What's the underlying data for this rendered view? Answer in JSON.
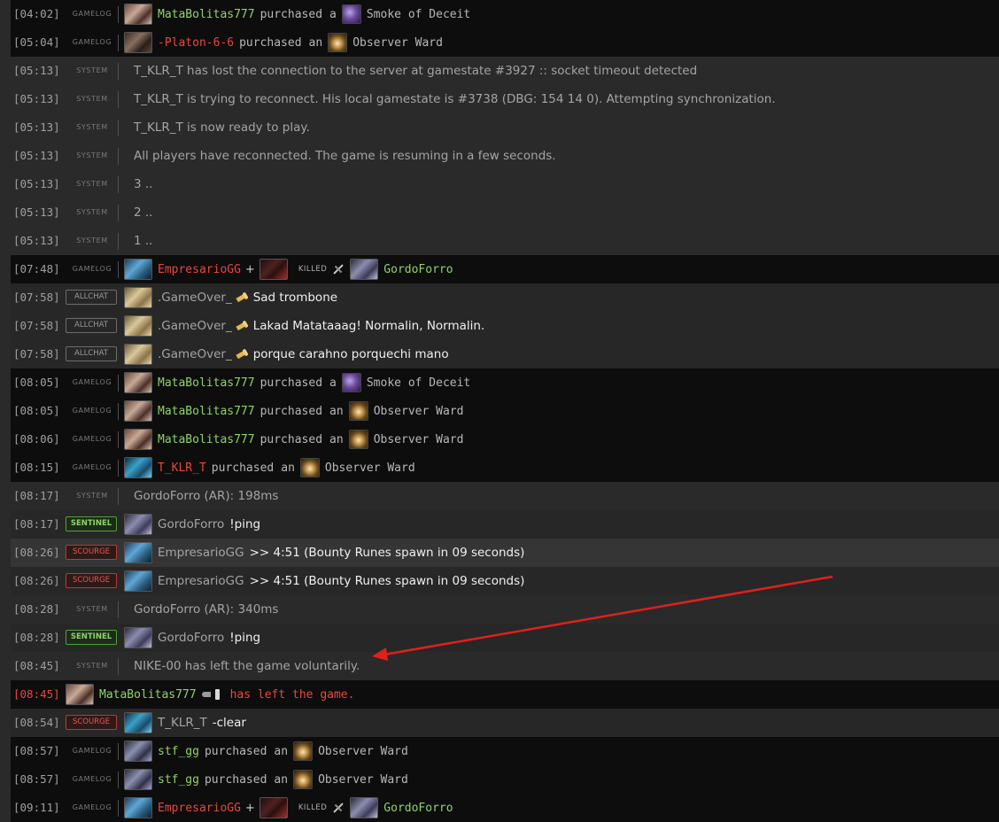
{
  "log": [
    {
      "kind": "gamelog",
      "time": "[04:02]",
      "tag": "GAMELOG",
      "avatar": "av-brown",
      "player": "MataBolitas777",
      "player_color": "green",
      "verb": "purchased",
      "article": "a",
      "item_icon": "ic-smoke",
      "item": "Smoke of Deceit"
    },
    {
      "kind": "gamelog",
      "time": "[05:04]",
      "tag": "GAMELOG",
      "avatar": "av-dark",
      "player": "-Platon-6-6",
      "player_color": "red",
      "verb": "purchased",
      "article": "an",
      "item_icon": "ic-ward",
      "item": "Observer Ward"
    },
    {
      "kind": "system",
      "time": "[05:13]",
      "tag": "SYSTEM",
      "text": "T_KLR_T has lost the connection to the server at gamestate #3927 :: socket timeout detected"
    },
    {
      "kind": "system",
      "time": "[05:13]",
      "tag": "SYSTEM",
      "text": "T_KLR_T is trying to reconnect. His local gamestate is #3738 (DBG: 154 14 0). Attempting synchronization."
    },
    {
      "kind": "system",
      "time": "[05:13]",
      "tag": "SYSTEM",
      "text": "T_KLR_T is now ready to play."
    },
    {
      "kind": "system",
      "time": "[05:13]",
      "tag": "SYSTEM",
      "text": "All players have reconnected. The game is resuming in a few seconds."
    },
    {
      "kind": "system",
      "time": "[05:13]",
      "tag": "SYSTEM",
      "text": "3 .."
    },
    {
      "kind": "system",
      "time": "[05:13]",
      "tag": "SYSTEM",
      "text": "2 .."
    },
    {
      "kind": "system",
      "time": "[05:13]",
      "tag": "SYSTEM",
      "text": "1 .."
    },
    {
      "kind": "kill",
      "time": "[07:48]",
      "tag": "GAMELOG",
      "avatar": "av-blue",
      "player": "EmpresarioGG",
      "plus": "+",
      "assist_avatar": "av-red",
      "killed": "KILLED",
      "victim_avatar": "av-purple",
      "victim": "GordoForro"
    },
    {
      "kind": "chat",
      "chan": "allchat",
      "time": "[07:58]",
      "chip": "ALLCHAT",
      "avatar": "av-tan",
      "player": ".GameOver_",
      "horn": true,
      "message": "Sad trombone"
    },
    {
      "kind": "chat",
      "chan": "allchat",
      "time": "[07:58]",
      "chip": "ALLCHAT",
      "avatar": "av-tan",
      "player": ".GameOver_",
      "horn": true,
      "message": "Lakad Matataaag! Normalin, Normalin."
    },
    {
      "kind": "chat",
      "chan": "allchat",
      "time": "[07:58]",
      "chip": "ALLCHAT",
      "avatar": "av-tan",
      "player": ".GameOver_",
      "horn": true,
      "message": "porque carahno porquechi mano"
    },
    {
      "kind": "gamelog",
      "time": "[08:05]",
      "tag": "GAMELOG",
      "avatar": "av-brown",
      "player": "MataBolitas777",
      "player_color": "green",
      "verb": "purchased",
      "article": "a",
      "item_icon": "ic-smoke",
      "item": "Smoke of Deceit"
    },
    {
      "kind": "gamelog",
      "time": "[08:05]",
      "tag": "GAMELOG",
      "avatar": "av-brown",
      "player": "MataBolitas777",
      "player_color": "green",
      "verb": "purchased",
      "article": "an",
      "item_icon": "ic-ward",
      "item": "Observer Ward"
    },
    {
      "kind": "gamelog",
      "time": "[08:06]",
      "tag": "GAMELOG",
      "avatar": "av-brown",
      "player": "MataBolitas777",
      "player_color": "green",
      "verb": "purchased",
      "article": "an",
      "item_icon": "ic-ward",
      "item": "Observer Ward"
    },
    {
      "kind": "gamelog",
      "time": "[08:15]",
      "tag": "GAMELOG",
      "avatar": "av-teal",
      "player": "T_KLR_T",
      "player_color": "red",
      "verb": "purchased",
      "article": "an",
      "item_icon": "ic-ward",
      "item": "Observer Ward"
    },
    {
      "kind": "system",
      "time": "[08:17]",
      "tag": "SYSTEM",
      "text": "GordoForro (AR): 198ms"
    },
    {
      "kind": "chat",
      "chan": "sentinel",
      "time": "[08:17]",
      "chip": "SENTINEL",
      "avatar": "av-purple",
      "player": "GordoForro",
      "horn": false,
      "message": "!ping"
    },
    {
      "kind": "chat",
      "chan": "scourge",
      "time": "[08:26]",
      "chip": "SCOURGE",
      "avatar": "av-blue",
      "player": "EmpresarioGG",
      "horn": false,
      "message": ">> 4:51 (Bounty Runes spawn in 09 seconds)",
      "highlight": true
    },
    {
      "kind": "chat",
      "chan": "scourge",
      "time": "[08:26]",
      "chip": "SCOURGE",
      "avatar": "av-blue",
      "player": "EmpresarioGG",
      "horn": false,
      "message": ">> 4:51 (Bounty Runes spawn in 09 seconds)"
    },
    {
      "kind": "system",
      "time": "[08:28]",
      "tag": "SYSTEM",
      "text": "GordoForro (AR): 340ms"
    },
    {
      "kind": "chat",
      "chan": "sentinel",
      "time": "[08:28]",
      "chip": "SENTINEL",
      "avatar": "av-purple",
      "player": "GordoForro",
      "horn": false,
      "message": "!ping"
    },
    {
      "kind": "system",
      "time": "[08:45]",
      "tag": "SYSTEM",
      "text": "NIKE-00 has left the game voluntarily."
    },
    {
      "kind": "leave",
      "time": "[08:45]",
      "avatar": "av-brown",
      "player": "MataBolitas777",
      "text": "has left the game."
    },
    {
      "kind": "chat",
      "chan": "scourge",
      "time": "[08:54]",
      "chip": "SCOURGE",
      "avatar": "av-teal",
      "player": "T_KLR_T",
      "horn": false,
      "message": "-clear"
    },
    {
      "kind": "gamelog",
      "time": "[08:57]",
      "tag": "GAMELOG",
      "avatar": "av-stf",
      "player": "stf_gg",
      "player_color": "green",
      "verb": "purchased",
      "article": "an",
      "item_icon": "ic-ward",
      "item": "Observer Ward"
    },
    {
      "kind": "gamelog",
      "time": "[08:57]",
      "tag": "GAMELOG",
      "avatar": "av-stf",
      "player": "stf_gg",
      "player_color": "green",
      "verb": "purchased",
      "article": "an",
      "item_icon": "ic-ward",
      "item": "Observer Ward"
    },
    {
      "kind": "kill",
      "time": "[09:11]",
      "tag": "GAMELOG",
      "avatar": "av-blue",
      "player": "EmpresarioGG",
      "plus": "+",
      "assist_avatar": "av-red",
      "killed": "KILLED",
      "victim_avatar": "av-purple",
      "victim": "GordoForro"
    }
  ],
  "annotation": {
    "arrow_color": "#e0201c"
  },
  "colors": {
    "player_green": "#8fd36a",
    "player_red": "#e8483c",
    "text_grey": "#a4a4a4",
    "gamelog_bg": "#0d0d0d",
    "system_bg": "#2a2a2a"
  }
}
